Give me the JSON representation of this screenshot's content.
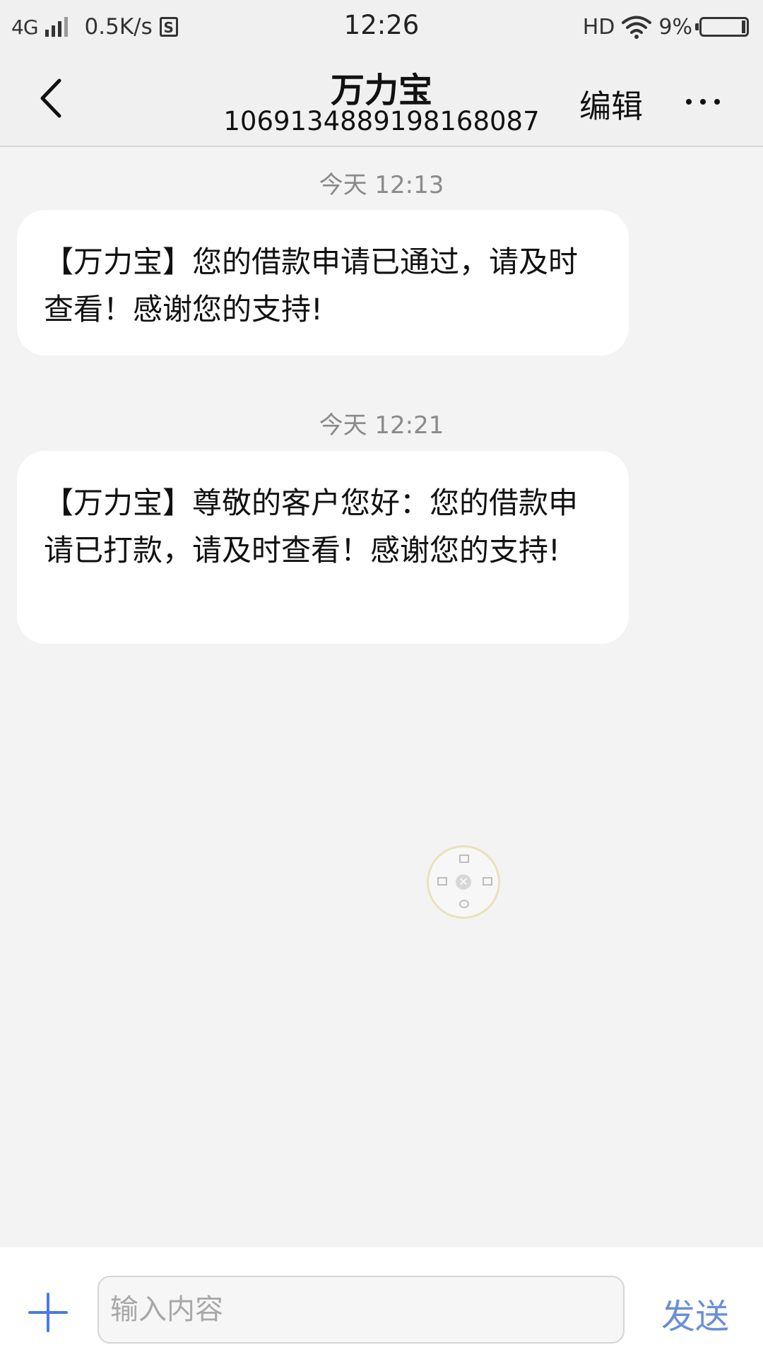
{
  "status_bar": {
    "network": "4G",
    "speed": "0.5K/s",
    "s_icon": "S",
    "time": "12:26",
    "hd": "HD",
    "battery": "9%",
    "battery_level": 0.09,
    "icons": [
      "signal-icon",
      "storage-icon",
      "wifi-icon",
      "battery-icon"
    ]
  },
  "header": {
    "title": "万力宝",
    "number": "1069134889198168087",
    "edit_label": "编辑",
    "icons": [
      "back-arrow-icon",
      "more-dots-icon"
    ]
  },
  "messages": [
    {
      "timestamp": "今天 12:13",
      "text": "【万力宝】您的借款申请已通过，请及时查看！感谢您的支持!"
    },
    {
      "timestamp": "今天 12:21",
      "text": "【万力宝】尊敬的客户您好：您的借款申请已打款，请及时查看！感谢您的支持!"
    }
  ],
  "composer": {
    "placeholder": "输入内容",
    "value": "",
    "send_label": "发送",
    "icons": [
      "plus-icon"
    ]
  },
  "colors": {
    "accent": "#4a7be0",
    "send": "#6a8fd9",
    "background": "#f3f3f3",
    "bubble": "#ffffff",
    "timestamp": "#8a8a8a"
  }
}
